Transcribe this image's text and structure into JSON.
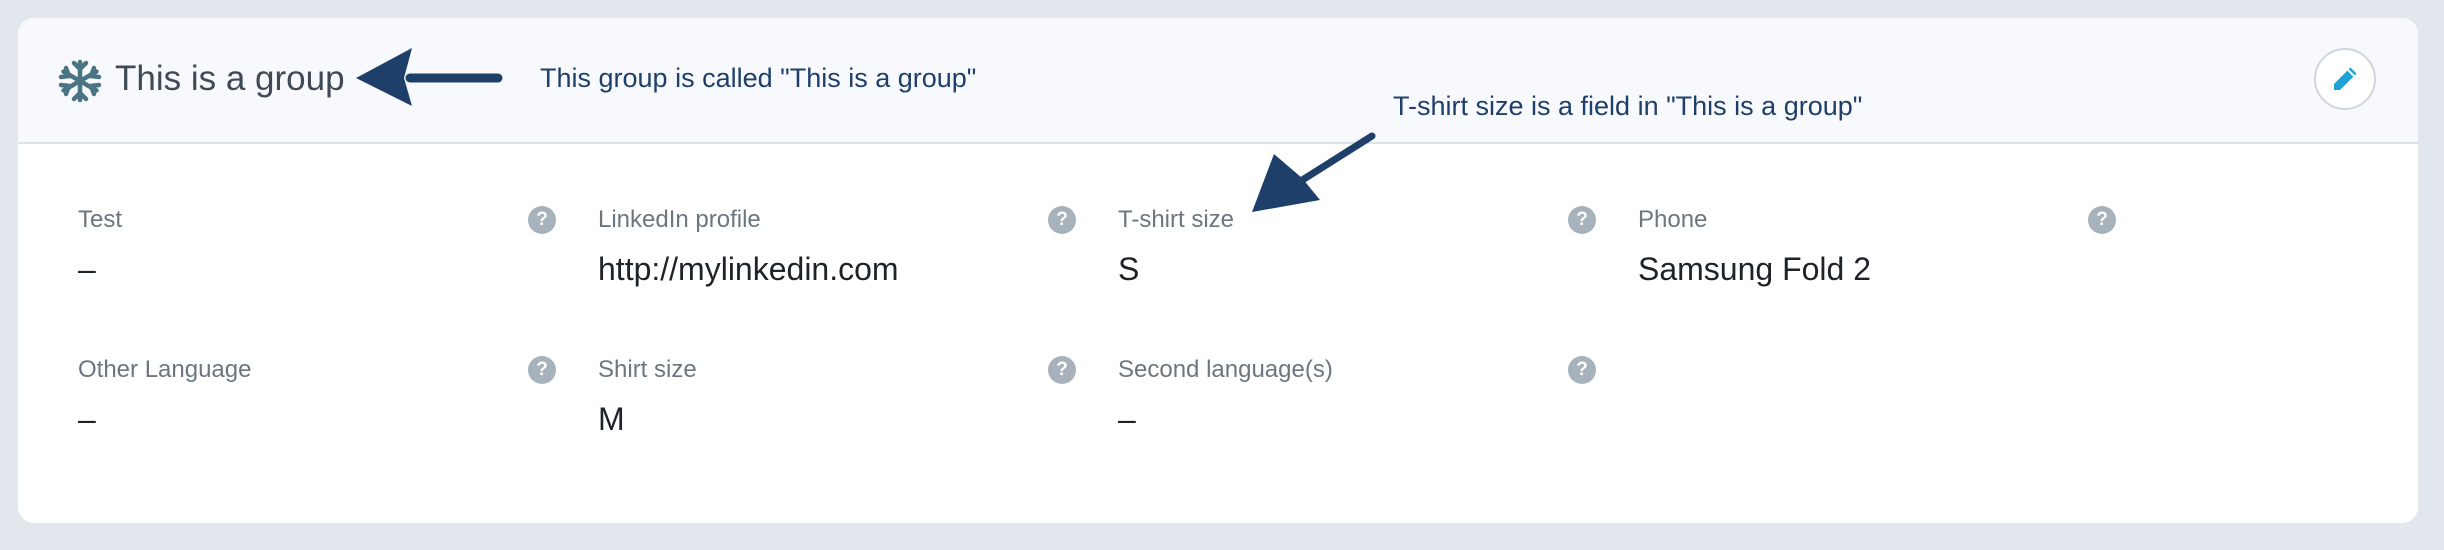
{
  "group": {
    "title": "This is a group",
    "icon": "snowflake-icon",
    "icon_color": "#4a7483",
    "edit_icon": "pencil-icon",
    "edit_icon_color": "#1da1d6"
  },
  "annotations": {
    "group_note": "This group is called \"This is a group\"",
    "field_note": "T-shirt size is a field in \"This is a group\"",
    "color": "#1e3f6a"
  },
  "help_glyph": "?",
  "fields": [
    {
      "label": "Test",
      "value": "–"
    },
    {
      "label": "LinkedIn profile",
      "value": "http://mylinkedin.com"
    },
    {
      "label": "T-shirt size",
      "value": "S"
    },
    {
      "label": "Phone",
      "value": "Samsung Fold 2"
    },
    {
      "label": "Other Language",
      "value": "–"
    },
    {
      "label": "Shirt size",
      "value": "M"
    },
    {
      "label": "Second language(s)",
      "value": "–"
    }
  ]
}
